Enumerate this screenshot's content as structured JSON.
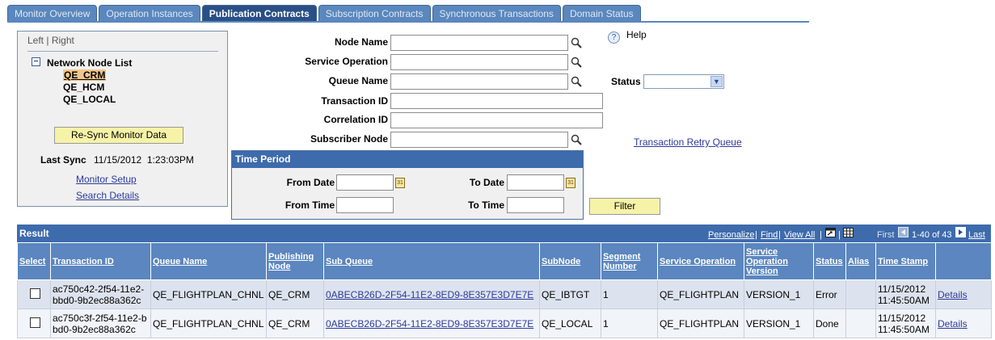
{
  "tabs": [
    "Monitor Overview",
    "Operation Instances",
    "Publication Contracts",
    "Subscription Contracts",
    "Synchronous Transactions",
    "Domain Status"
  ],
  "active_tab": "Publication Contracts",
  "left": {
    "left_link": "Left",
    "sep": "|",
    "right_link": "Right",
    "tree_title": "Network Node List",
    "nodes": [
      "QE_CRM",
      "QE_HCM",
      "QE_LOCAL"
    ],
    "resync": "Re-Sync Monitor Data",
    "last_sync_label": "Last Sync",
    "last_sync_value": "11/15/2012  1:23:03PM",
    "monitor_setup": "Monitor Setup",
    "search_details": "Search Details"
  },
  "form": {
    "node_name": "Node Name",
    "service_operation": "Service Operation",
    "queue_name": "Queue Name",
    "transaction_id": "Transaction ID",
    "correlation_id": "Correlation ID",
    "subscriber_node": "Subscriber Node",
    "help": "Help",
    "status": "Status",
    "retry_queue": "Transaction Retry Queue",
    "time_period": "Time Period",
    "from_date": "From Date",
    "to_date": "To Date",
    "from_time": "From Time",
    "to_time": "To Time",
    "filter": "Filter"
  },
  "grid": {
    "title": "Result",
    "personalize": "Personalize",
    "find": "Find",
    "view_all": "View All",
    "first": "First",
    "range": "1-40 of 43",
    "last": "Last",
    "headers": [
      "Select",
      "Transaction ID",
      "Queue Name",
      "Publishing Node",
      "Sub Queue",
      "SubNode",
      "Segment Number",
      "Service Operation",
      "Service Operation Version",
      "Status",
      "Alias",
      "Time Stamp",
      ""
    ],
    "rows": [
      {
        "txn": "ac750c42-2f54-11e2-bbd0-9b2ec88a362c",
        "queue": "QE_FLIGHTPLAN_CHNL",
        "pub": "QE_CRM",
        "subq": "0ABECB26D-2F54-11E2-8ED9-8E357E3D7E7E",
        "subnode": "QE_IBTGT",
        "seg": "1",
        "svc": "QE_FLIGHTPLAN",
        "ver": "VERSION_1",
        "status": "Error",
        "alias": "",
        "ts": "11/15/2012 11:45:50AM",
        "details": "Details"
      },
      {
        "txn": "ac750c3f-2f54-11e2-bbd0-9b2ec88a362c",
        "queue": "QE_FLIGHTPLAN_CHNL",
        "pub": "QE_CRM",
        "subq": "0ABECB26D-2F54-11E2-8ED9-8E357E3D7E7E",
        "subnode": "QE_LOCAL",
        "seg": "1",
        "svc": "QE_FLIGHTPLAN",
        "ver": "VERSION_1",
        "status": "Done",
        "alias": "",
        "ts": "11/15/2012 11:45:50AM",
        "details": "Details"
      }
    ]
  },
  "colors": {
    "tab": "#5a87bd",
    "tab_active": "#2a4f86",
    "grid_header": "#3e6bac",
    "button": "#f6f3a8"
  }
}
